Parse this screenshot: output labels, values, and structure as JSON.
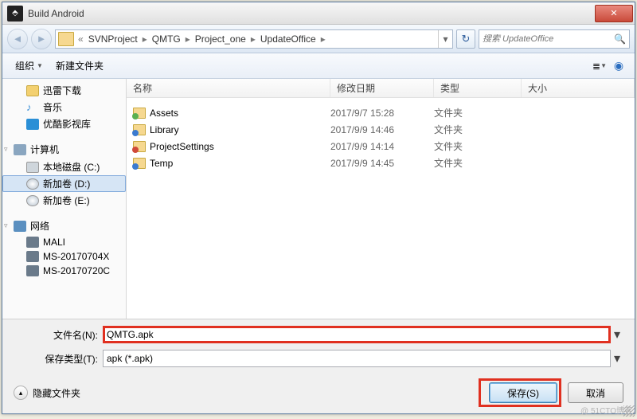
{
  "titlebar": {
    "title": "Build Android"
  },
  "breadcrumb": {
    "root_sep": "«",
    "items": [
      "SVNProject",
      "QMTG",
      "Project_one",
      "UpdateOffice"
    ]
  },
  "search": {
    "placeholder": "搜索 UpdateOffice"
  },
  "toolbar": {
    "organize": "组织",
    "new_folder": "新建文件夹"
  },
  "sidebar": {
    "favorites": [
      {
        "label": "迅雷下载",
        "icon": "ic-dl"
      },
      {
        "label": "音乐",
        "icon": "ic-music"
      },
      {
        "label": "优酷影视库",
        "icon": "ic-video"
      }
    ],
    "computer": {
      "head": "计算机",
      "items": [
        {
          "label": "本地磁盘 (C:)",
          "icon": "ic-drive"
        },
        {
          "label": "新加卷 (D:)",
          "icon": "ic-cd",
          "selected": true
        },
        {
          "label": "新加卷 (E:)",
          "icon": "ic-cd"
        }
      ]
    },
    "network": {
      "head": "网络",
      "items": [
        {
          "label": "MALI",
          "icon": "ic-nethost"
        },
        {
          "label": "MS-20170704X",
          "icon": "ic-nethost"
        },
        {
          "label": "MS-20170720C",
          "icon": "ic-nethost"
        }
      ]
    }
  },
  "headers": {
    "name": "名称",
    "date": "修改日期",
    "type": "类型",
    "size": "大小"
  },
  "files": [
    {
      "name": "Assets",
      "date": "2017/9/7 15:28",
      "type": "文件夹",
      "icon": "green"
    },
    {
      "name": "Library",
      "date": "2017/9/9 14:46",
      "type": "文件夹",
      "icon": "blue"
    },
    {
      "name": "ProjectSettings",
      "date": "2017/9/9 14:14",
      "type": "文件夹",
      "icon": "red"
    },
    {
      "name": "Temp",
      "date": "2017/9/9 14:45",
      "type": "文件夹",
      "icon": "blue"
    }
  ],
  "fields": {
    "filename_label": "文件名(N):",
    "filename_value": "QMTG.apk",
    "filetype_label": "保存类型(T):",
    "filetype_value": "apk (*.apk)"
  },
  "footer": {
    "hide_folders": "隐藏文件夹",
    "save": "保存(S)",
    "cancel": "取消"
  },
  "watermark": "@ 51CTO博客"
}
